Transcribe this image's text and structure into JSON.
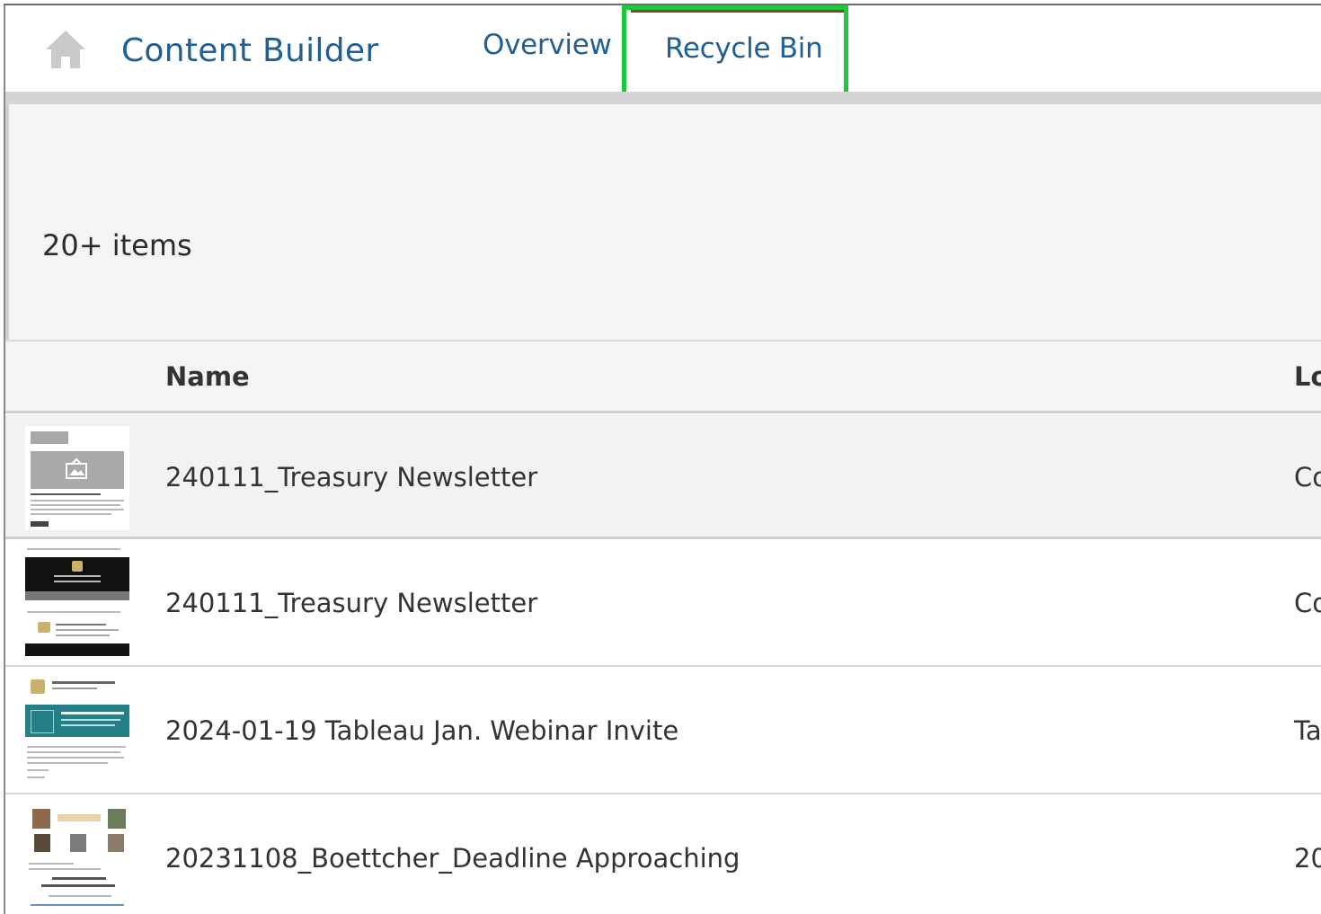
{
  "header": {
    "app_title": "Content Builder",
    "tabs": [
      {
        "label": "Overview",
        "selected": false
      },
      {
        "label": "Recycle Bin",
        "selected": true
      }
    ],
    "icons": {
      "home": "home-icon"
    },
    "colors": {
      "link": "#1f5f96",
      "highlight": "#1ec83c"
    }
  },
  "summary": {
    "item_count": "20+ items"
  },
  "table": {
    "columns": [
      "Name",
      "Lo"
    ],
    "rows": [
      {
        "name": "240111_Treasury Newsletter",
        "location": "Co"
      },
      {
        "name": "240111_Treasury Newsletter",
        "location": "Co"
      },
      {
        "name": "2024-01-19 Tableau Jan. Webinar Invite",
        "location": "Ta"
      },
      {
        "name": "20231108_Boettcher_Deadline Approaching",
        "location": "20"
      }
    ]
  }
}
